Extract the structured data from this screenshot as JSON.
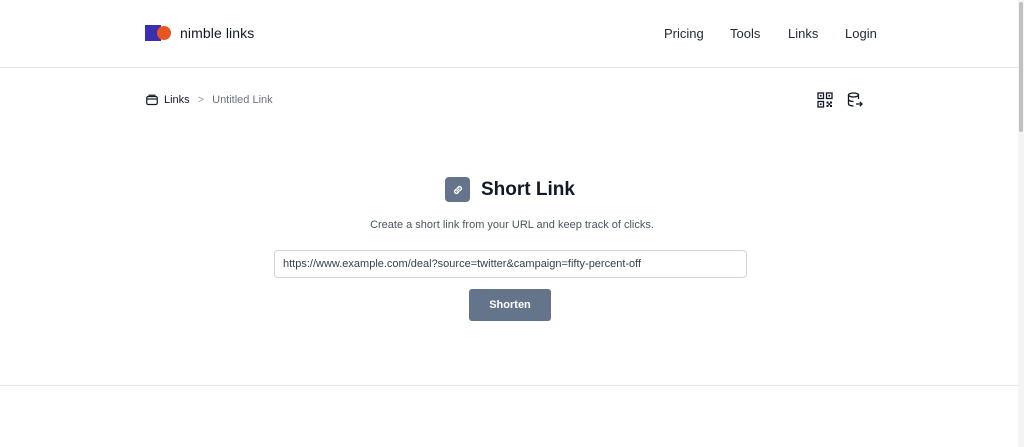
{
  "brand": {
    "name": "nimble links",
    "colors": {
      "square": "#3b2fb0",
      "circle": "#e8551f"
    }
  },
  "nav": {
    "items": [
      "Pricing",
      "Tools",
      "Links",
      "Login"
    ]
  },
  "breadcrumb": {
    "root": "Links",
    "current": "Untitled Link",
    "separator": ">"
  },
  "toolbar": {
    "icons": [
      "qr-code-icon",
      "database-export-icon"
    ]
  },
  "main": {
    "title": "Short Link",
    "title_icon": "link-icon",
    "subtitle": "Create a short link from your URL and keep track of clicks.",
    "url_value": "https://www.example.com/deal?source=twitter&campaign=fifty-percent-off",
    "button_label": "Shorten",
    "accent": "#64748b"
  }
}
